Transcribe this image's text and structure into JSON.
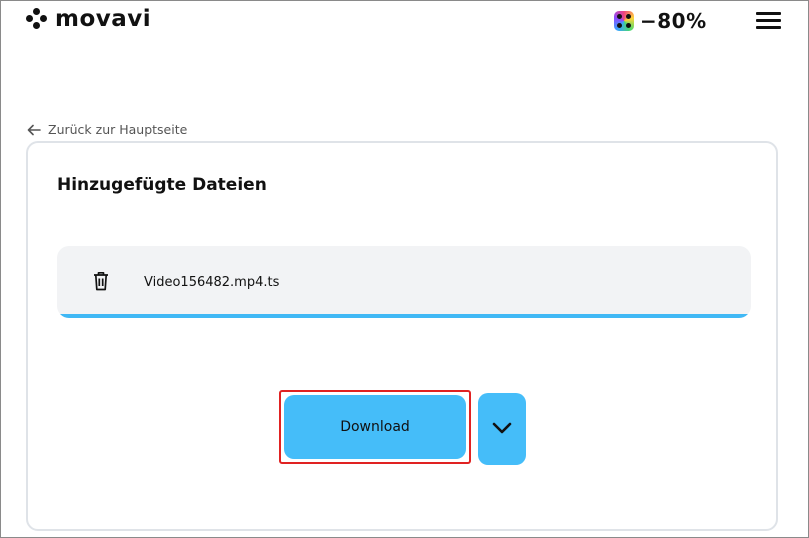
{
  "header": {
    "brand": "movavi",
    "promo": "−80%",
    "menu_icon": "hamburger-menu-icon"
  },
  "nav": {
    "back_label": "Zurück zur Hauptseite"
  },
  "card": {
    "title": "Hinzugefügte Dateien",
    "files": [
      {
        "name": "Video156482.mp4.ts",
        "progress": 1.0
      }
    ]
  },
  "actions": {
    "download_label": "Download",
    "dropdown_icon": "chevron-down-icon"
  },
  "colors": {
    "accent": "#45bdf9",
    "progress": "#40b8f5",
    "highlight": "#e02222",
    "row_bg": "#f2f3f5"
  }
}
